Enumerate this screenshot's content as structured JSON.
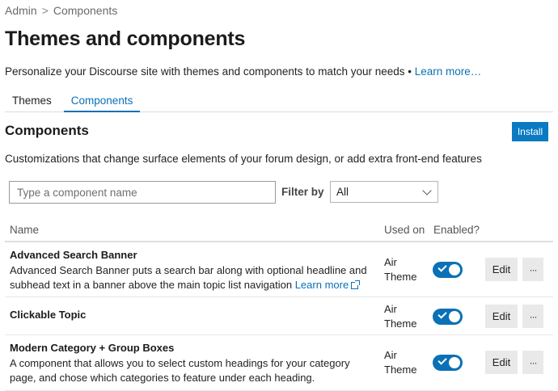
{
  "breadcrumb": {
    "root": "Admin",
    "separator": ">",
    "current": "Components"
  },
  "page": {
    "title": "Themes and components",
    "intro": "Personalize your Discourse site with themes and components to match your needs •",
    "intro_link": "Learn more…"
  },
  "tabs": [
    {
      "label": "Themes",
      "active": false
    },
    {
      "label": "Components",
      "active": true
    }
  ],
  "section": {
    "title": "Components",
    "install_label": "Install",
    "description": "Customizations that change surface elements of your forum design, or add extra front-end features"
  },
  "filters": {
    "search_placeholder": "Type a component name",
    "filter_label": "Filter by",
    "filter_value": "All"
  },
  "table": {
    "headers": {
      "name": "Name",
      "used_on": "Used on",
      "enabled": "Enabled?"
    },
    "rows": [
      {
        "name": "Advanced Search Banner",
        "description": "Advanced Search Banner puts a search bar along with optional headline and subhead text in a banner above the main topic list navigation",
        "link": "Learn more",
        "used_on_1": "Air",
        "used_on_2": "Theme",
        "enabled": true,
        "edit_label": "Edit",
        "more_label": "···"
      },
      {
        "name": "Clickable Topic",
        "description": "",
        "used_on_1": "Air",
        "used_on_2": "Theme",
        "enabled": true,
        "edit_label": "Edit",
        "more_label": "···"
      },
      {
        "name": "Modern Category + Group Boxes",
        "description": "A component that allows you to select custom headings for your category page, and chose which categories to feature under each heading.",
        "used_on_1": "Air",
        "used_on_2": "Theme",
        "enabled": true,
        "edit_label": "Edit",
        "more_label": "···"
      }
    ]
  },
  "colors": {
    "accent": "#0a71b6",
    "button_primary": "#0a7ac2",
    "button_secondary": "#e9e9e9"
  }
}
